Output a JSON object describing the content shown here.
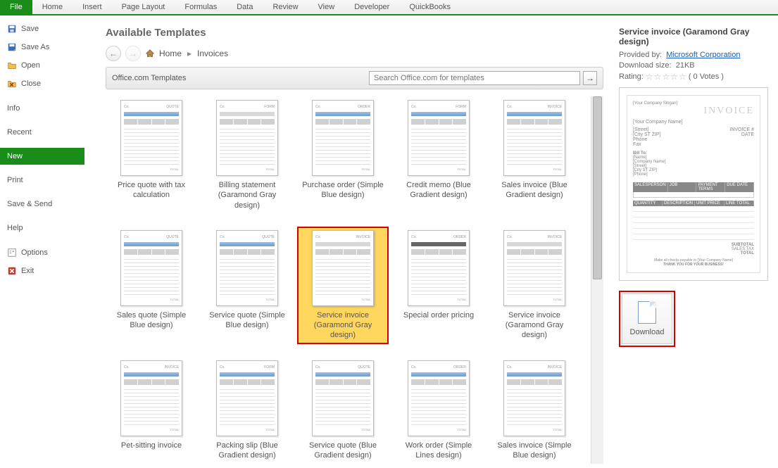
{
  "ribbon": {
    "tabs": [
      "File",
      "Home",
      "Insert",
      "Page Layout",
      "Formulas",
      "Data",
      "Review",
      "View",
      "Developer",
      "QuickBooks"
    ],
    "active": "File"
  },
  "sidebar": {
    "items": [
      {
        "icon": "save",
        "label": "Save"
      },
      {
        "icon": "saveas",
        "label": "Save As"
      },
      {
        "icon": "open",
        "label": "Open"
      },
      {
        "icon": "close",
        "label": "Close"
      }
    ],
    "section2": [
      "Info",
      "Recent",
      "New",
      "Print",
      "Save & Send",
      "Help"
    ],
    "footer": [
      {
        "icon": "options",
        "label": "Options"
      },
      {
        "icon": "exit",
        "label": "Exit"
      }
    ],
    "selected": "New"
  },
  "content": {
    "heading": "Available Templates",
    "breadcrumb": {
      "home": "Home",
      "current": "Invoices"
    },
    "section_title": "Office.com Templates",
    "search_placeholder": "Search Office.com for templates",
    "templates": [
      "Price quote with tax calculation",
      "Billing statement (Garamond Gray design)",
      "Purchase order (Simple Blue design)",
      "Credit memo (Blue Gradient design)",
      "Sales invoice (Blue Gradient design)",
      "Sales quote (Simple Blue design)",
      "Service quote (Simple Blue design)",
      "Service invoice (Garamond Gray design)",
      "Special order pricing",
      "Service invoice (Garamond Gray design)",
      "Pet-sitting invoice",
      "Packing slip (Blue Gradient design)",
      "Service quote (Blue Gradient design)",
      "Work order (Simple Lines design)",
      "Sales invoice (Simple Blue design)"
    ],
    "selected_index": 7
  },
  "preview": {
    "title": "Service invoice (Garamond Gray design)",
    "provided_by_label": "Provided by:",
    "provided_by": "Microsoft Corporation",
    "size_label": "Download size:",
    "size": "21KB",
    "rating_label": "Rating:",
    "votes": "( 0 Votes )",
    "button": "Download",
    "doc": {
      "title": "INVOICE",
      "owner": "[Your Company Name]",
      "thank": "THANK YOU FOR YOUR BUSINESS!"
    }
  }
}
